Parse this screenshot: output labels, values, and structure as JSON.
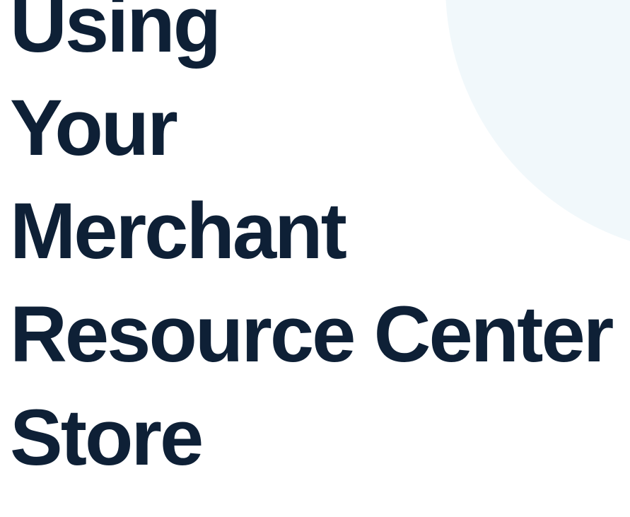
{
  "slide": {
    "background_color": "#ffffff",
    "accent_shape_color": "#f1f8fb",
    "title_color": "#0e2036",
    "title_lines": [
      "Using",
      "Your",
      "Merchant",
      "Resource Center",
      "Store"
    ]
  }
}
